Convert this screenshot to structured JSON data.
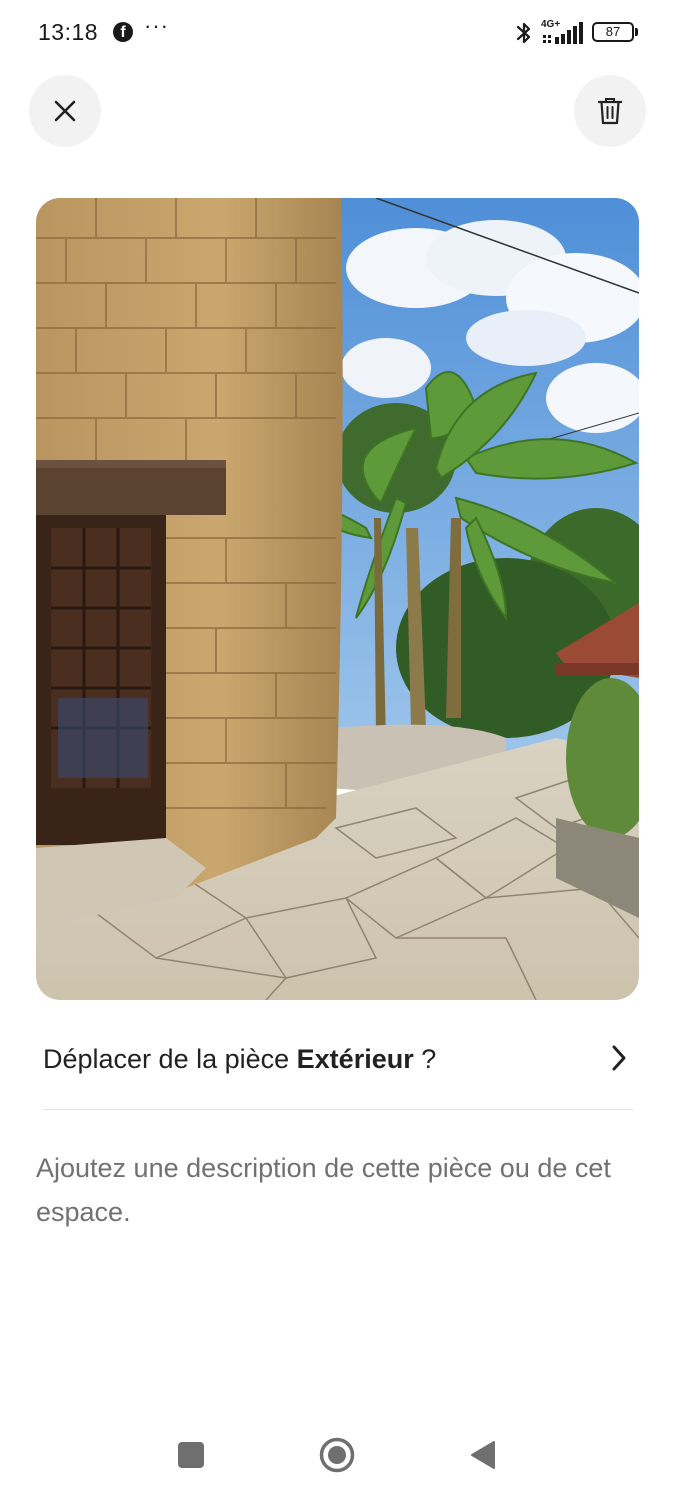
{
  "status_bar": {
    "time": "13:18",
    "more": "···",
    "network": "4G+",
    "battery": "87",
    "icons": [
      "facebook-icon",
      "bluetooth-icon",
      "signal-icon",
      "battery-icon"
    ]
  },
  "header": {
    "close_icon": "close-icon",
    "delete_icon": "trash-icon"
  },
  "photo": {
    "subject": "stone-tower-exterior-photo"
  },
  "move": {
    "prefix": "Déplacer de la pièce ",
    "room": "Extérieur",
    "suffix": " ?",
    "icon": "chevron-right-icon"
  },
  "description": {
    "placeholder": "Ajoutez une description de cette pièce ou de cet espace."
  },
  "nav": {
    "icons": [
      "recents-icon",
      "home-icon",
      "back-icon"
    ]
  },
  "colors": {
    "text": "#222222",
    "muted": "#717171",
    "button_bg": "#f2f2f2",
    "divider": "#e3e3e3"
  }
}
